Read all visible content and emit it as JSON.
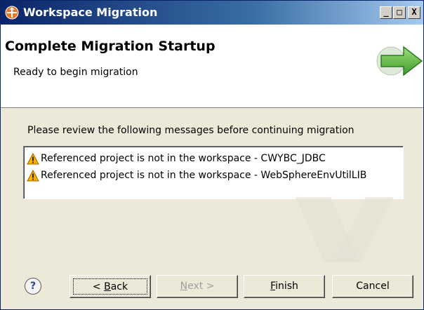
{
  "window": {
    "title": "Workspace Migration",
    "controls": {
      "minimize": "_",
      "maximize": "□",
      "close": "X"
    }
  },
  "header": {
    "title": "Complete Migration Startup",
    "subtitle": "Ready to begin migration",
    "icon": "migration-arrow-icon"
  },
  "content": {
    "instructions": "Please review the following messages before continuing migration",
    "messages": [
      {
        "icon": "warning-icon",
        "text": "Referenced project is not in the workspace - CWYBC_JDBC"
      },
      {
        "icon": "warning-icon",
        "text": "Referenced project is not in the workspace - WebSphereEnvUtilLIB"
      }
    ]
  },
  "footer": {
    "help": "?",
    "back_prefix": "< ",
    "back_mnemonic": "B",
    "back_rest": "ack",
    "next_mnemonic": "N",
    "next_rest": "ext >",
    "finish_mnemonic": "F",
    "finish_rest": "inish",
    "cancel": "Cancel"
  },
  "colors": {
    "title_bar": "#0a246a",
    "dialog_bg": "#ece9d8",
    "header_bg": "#ffffff",
    "warning": "#f5b000",
    "arrow": "#4caf3a"
  }
}
